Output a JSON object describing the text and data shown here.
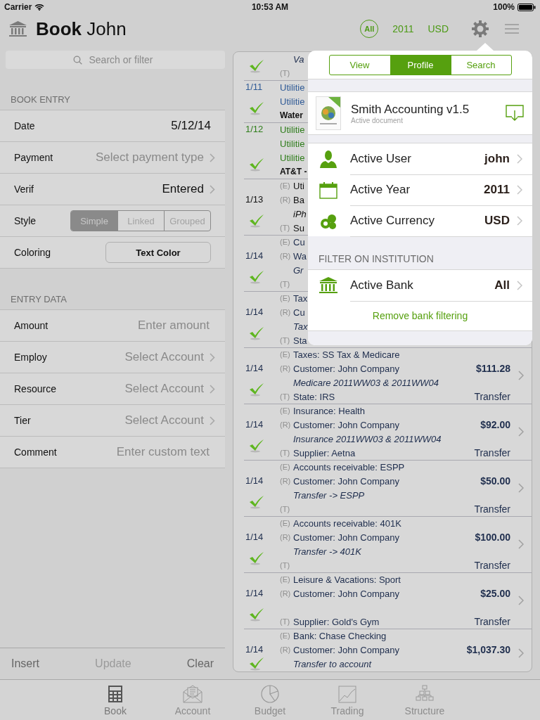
{
  "status_bar": {
    "carrier": "Carrier",
    "time": "10:53 AM",
    "battery": "100%"
  },
  "header": {
    "title": "**Book** John",
    "filters": [
      {
        "kind": "circle",
        "label": "All"
      },
      {
        "kind": "text",
        "label": "2011"
      },
      {
        "kind": "text",
        "label": "USD"
      }
    ]
  },
  "search": {
    "placeholder": "Search or filter"
  },
  "sections": [
    {
      "title": "BOOK ENTRY",
      "rows": [
        {
          "label": "Date",
          "kind": "value",
          "value": "5/12/14"
        },
        {
          "label": "Payment",
          "kind": "select",
          "placeholder": "Select payment type"
        },
        {
          "label": "Verif",
          "kind": "select",
          "value": "Entered"
        },
        {
          "label": "Style",
          "kind": "segmented",
          "options": [
            {
              "label": "Simple",
              "selected": true
            },
            {
              "label": "Linked",
              "selected": false
            },
            {
              "label": "Grouped",
              "selected": false
            }
          ]
        },
        {
          "label": "Coloring",
          "kind": "button",
          "button": "Text Color"
        }
      ]
    },
    {
      "title": "ENTRY DATA",
      "rows": [
        {
          "label": "Amount",
          "kind": "input",
          "placeholder": "Enter amount"
        },
        {
          "label": "Employ",
          "kind": "select",
          "placeholder": "Select Account"
        },
        {
          "label": "Resource",
          "kind": "select",
          "placeholder": "Select Account"
        },
        {
          "label": "Tier",
          "kind": "select",
          "placeholder": "Select Account"
        },
        {
          "label": "Comment",
          "kind": "input",
          "placeholder": "Enter custom text"
        }
      ]
    }
  ],
  "actions": [
    {
      "label": "Insert",
      "disabled": false
    },
    {
      "label": "Update",
      "disabled": true
    },
    {
      "label": "Clear",
      "disabled": false
    }
  ],
  "transactions": [
    {
      "color": "#1e2d4d",
      "checked": true,
      "lines": [
        {
          "kind": "memo",
          "text": "Va"
        },
        {
          "kind": "entry",
          "tag": "(T)"
        }
      ]
    },
    {
      "date": "1/11",
      "color": "#2f5a96",
      "checked": true,
      "lines": [
        {
          "kind": "entry",
          "text": "Utilitie"
        },
        {
          "kind": "entry",
          "text": "Utilitie"
        },
        {
          "kind": "note",
          "text": "Water"
        }
      ]
    },
    {
      "date": "1/12",
      "color": "#2e7d1a",
      "checked": true,
      "lines": [
        {
          "kind": "entry",
          "text": "Utilitie"
        },
        {
          "kind": "entry",
          "text": "Utilitie"
        },
        {
          "kind": "entry",
          "text": "Utilitie"
        },
        {
          "kind": "note",
          "text": "AT&T -"
        }
      ]
    },
    {
      "date": "1/13",
      "color": "#111111",
      "checked": true,
      "lines": [
        {
          "kind": "entry",
          "tag": "(E)",
          "text": "Uti"
        },
        {
          "kind": "entry",
          "tag": "(R)",
          "text": "Ba"
        },
        {
          "kind": "memo",
          "text": "iPh"
        },
        {
          "kind": "entry",
          "tag": "(T)",
          "text": "Su"
        }
      ]
    },
    {
      "date": "1/14",
      "color": "#1e2d4d",
      "checked": true,
      "lines": [
        {
          "kind": "entry",
          "tag": "(E)",
          "text": "Cu"
        },
        {
          "kind": "entry",
          "tag": "(R)",
          "text": "Wa"
        },
        {
          "kind": "memo",
          "text": "Gr"
        },
        {
          "kind": "entry",
          "tag": "(T)"
        }
      ]
    },
    {
      "date": "1/14",
      "color": "#1e2d4d",
      "checked": true,
      "lines": [
        {
          "kind": "entry",
          "tag": "(E)",
          "text": "Tax"
        },
        {
          "kind": "entry",
          "tag": "(R)",
          "text": "Cu"
        },
        {
          "kind": "memo",
          "text": "Tax"
        },
        {
          "kind": "entry",
          "tag": "(T)",
          "text": "Sta"
        }
      ]
    },
    {
      "date": "1/14",
      "color": "#1e2d4d",
      "checked": true,
      "amount": "$111.28",
      "type": "Transfer",
      "lines": [
        {
          "kind": "entry",
          "tag": "(E)",
          "text": "Taxes: SS Tax & Medicare"
        },
        {
          "kind": "entry",
          "tag": "(R)",
          "text": "Customer: John Company"
        },
        {
          "kind": "memo",
          "text": "Medicare 2011WW03 & 2011WW04"
        },
        {
          "kind": "entry",
          "tag": "(T)",
          "text": "State: IRS"
        }
      ]
    },
    {
      "date": "1/14",
      "color": "#1e2d4d",
      "checked": true,
      "amount": "$92.00",
      "type": "Transfer",
      "lines": [
        {
          "kind": "entry",
          "tag": "(E)",
          "text": "Insurance: Health"
        },
        {
          "kind": "entry",
          "tag": "(R)",
          "text": "Customer: John Company"
        },
        {
          "kind": "memo",
          "text": "Insurance 2011WW03 & 2011WW04"
        },
        {
          "kind": "entry",
          "tag": "(T)",
          "text": "Supplier: Aetna"
        }
      ]
    },
    {
      "date": "1/14",
      "color": "#1e2d4d",
      "checked": true,
      "amount": "$50.00",
      "type": "Transfer",
      "lines": [
        {
          "kind": "entry",
          "tag": "(E)",
          "text": "Accounts receivable: ESPP"
        },
        {
          "kind": "entry",
          "tag": "(R)",
          "text": "Customer: John Company"
        },
        {
          "kind": "memo",
          "text": "Transfer -> ESPP"
        },
        {
          "kind": "entry",
          "tag": "(T)"
        }
      ]
    },
    {
      "date": "1/14",
      "color": "#1e2d4d",
      "checked": true,
      "amount": "$100.00",
      "type": "Transfer",
      "lines": [
        {
          "kind": "entry",
          "tag": "(E)",
          "text": "Accounts receivable: 401K"
        },
        {
          "kind": "entry",
          "tag": "(R)",
          "text": "Customer: John Company"
        },
        {
          "kind": "memo",
          "text": "Transfer -> 401K"
        },
        {
          "kind": "entry",
          "tag": "(T)"
        }
      ]
    },
    {
      "date": "1/14",
      "color": "#1e2d4d",
      "checked": true,
      "amount": "$25.00",
      "type": "Transfer",
      "lines": [
        {
          "kind": "entry",
          "tag": "(E)",
          "text": "Leisure & Vacations: Sport"
        },
        {
          "kind": "entry",
          "tag": "(R)",
          "text": "Customer: John Company"
        },
        {
          "kind": "memo"
        },
        {
          "kind": "entry",
          "tag": "(T)",
          "text": "Supplier: Gold's Gym"
        }
      ]
    },
    {
      "date": "1/14",
      "color": "#1e2d4d",
      "checked": true,
      "amount": "$1,037.30",
      "lines": [
        {
          "kind": "entry",
          "tag": "(E)",
          "text": "Bank: Chase Checking"
        },
        {
          "kind": "entry",
          "tag": "(R)",
          "text": "Customer: John Company"
        },
        {
          "kind": "memo",
          "text": "Transfer to account"
        }
      ]
    }
  ],
  "popover": {
    "tabs": [
      {
        "label": "View",
        "selected": false
      },
      {
        "label": "Profile",
        "selected": true
      },
      {
        "label": "Search",
        "selected": false
      }
    ],
    "document": {
      "title": "Smith Accounting v1.5",
      "subtitle": "Active document"
    },
    "settings": [
      {
        "label": "Active User",
        "value": "john"
      },
      {
        "label": "Active Year",
        "value": "2011"
      },
      {
        "label": "Active Currency",
        "value": "USD"
      }
    ],
    "filter_header": "FILTER ON INSTITUTION",
    "bank": {
      "label": "Active Bank",
      "value": "All"
    },
    "link": "Remove bank filtering"
  },
  "tab_bar": [
    {
      "label": "Book",
      "selected": true
    },
    {
      "label": "Account",
      "selected": false
    },
    {
      "label": "Budget",
      "selected": false
    },
    {
      "label": "Trading",
      "selected": false
    },
    {
      "label": "Structure",
      "selected": false
    }
  ]
}
